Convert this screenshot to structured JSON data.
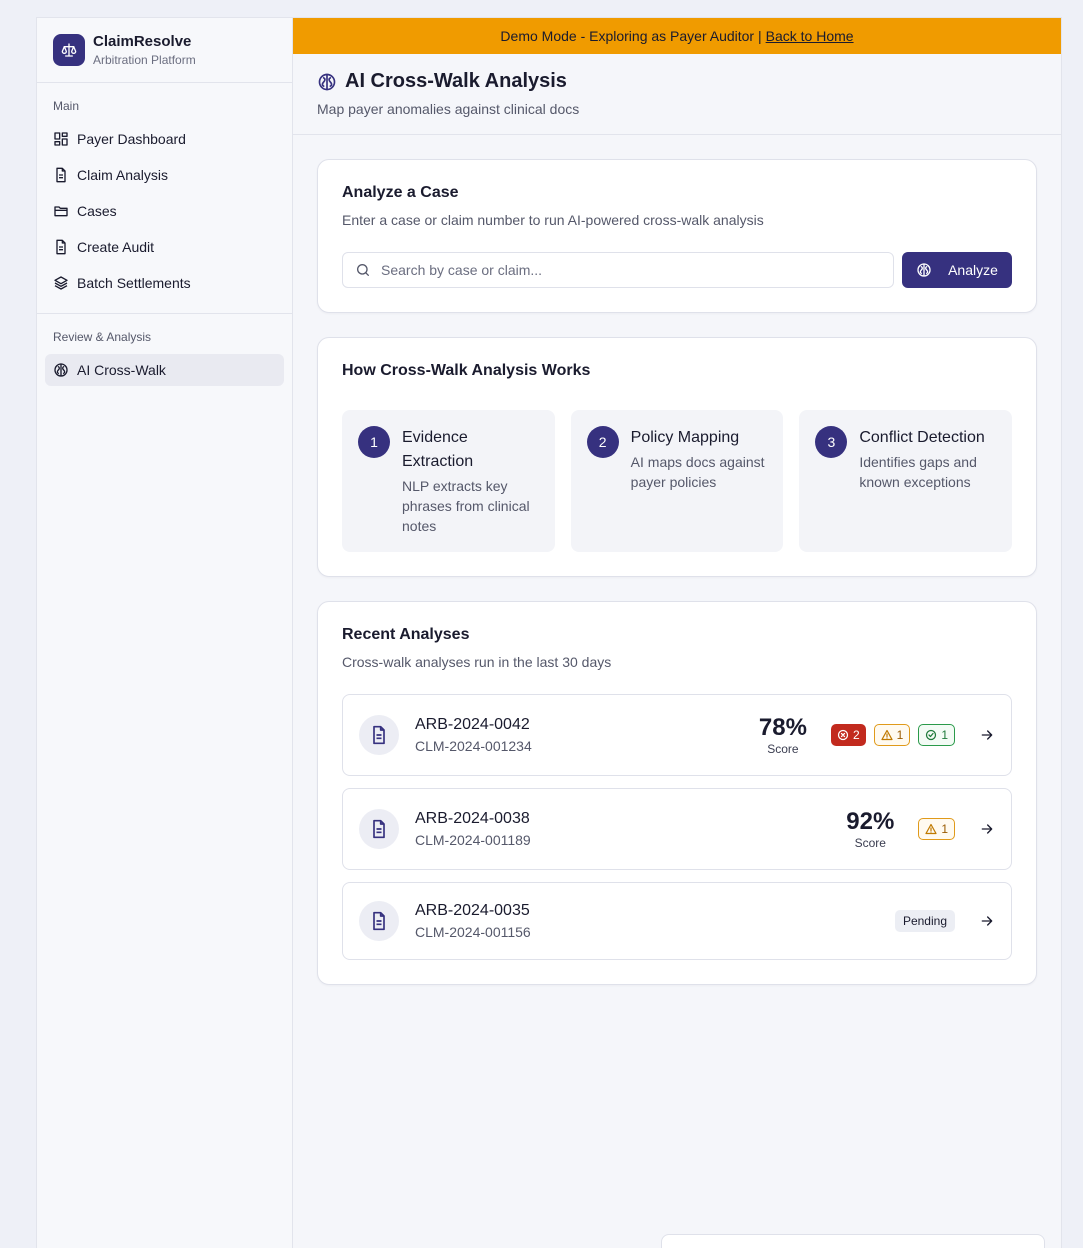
{
  "colors": {
    "primary": "#36317f",
    "banner": "#f09b00",
    "danger": "#c22a1e",
    "warning": "#e09a1a",
    "success": "#2a9a4a"
  },
  "brand": {
    "name": "ClaimResolve",
    "subtitle": "Arbitration Platform",
    "icon": "scale-icon"
  },
  "banner": {
    "text": "Demo Mode - Exploring as Payer Auditor |",
    "link": "Back to Home"
  },
  "sidebar": {
    "sections": [
      {
        "heading": "Main",
        "items": [
          {
            "label": "Payer Dashboard",
            "icon": "dashboard-icon"
          },
          {
            "label": "Claim Analysis",
            "icon": "document-icon"
          },
          {
            "label": "Cases",
            "icon": "folder-icon"
          },
          {
            "label": "Create Audit",
            "icon": "document-icon"
          },
          {
            "label": "Batch Settlements",
            "icon": "layers-icon"
          }
        ]
      },
      {
        "heading": "Review & Analysis",
        "items": [
          {
            "label": "AI Cross-Walk",
            "icon": "brain-icon",
            "active": true
          }
        ]
      }
    ]
  },
  "header": {
    "title": "AI Cross-Walk Analysis",
    "subtitle": "Map payer anomalies against clinical docs"
  },
  "analyze": {
    "title": "Analyze a Case",
    "description": "Enter a case or claim number to run AI-powered cross-walk analysis",
    "search_placeholder": "Search by case or claim...",
    "search_value": "",
    "button_label": "Analyze"
  },
  "how": {
    "title": "How Cross-Walk Analysis Works",
    "steps": [
      {
        "number": "1",
        "title": "Evidence Extraction",
        "description": "NLP extracts key phrases from clinical notes"
      },
      {
        "number": "2",
        "title": "Policy Mapping",
        "description": "AI maps docs against payer policies"
      },
      {
        "number": "3",
        "title": "Conflict Detection",
        "description": "Identifies gaps and known exceptions"
      }
    ]
  },
  "recent": {
    "title": "Recent Analyses",
    "description": "Cross-walk analyses run in the last 30 days",
    "rows": [
      {
        "case": "ARB-2024-0042",
        "claim": "CLM-2024-001234",
        "score": "78%",
        "score_label": "Score",
        "conflicts": "2",
        "warnings": "1",
        "passes": "1"
      },
      {
        "case": "ARB-2024-0038",
        "claim": "CLM-2024-001189",
        "score": "92%",
        "score_label": "Score",
        "warnings": "1"
      },
      {
        "case": "ARB-2024-0035",
        "claim": "CLM-2024-001156",
        "status": "Pending"
      }
    ]
  }
}
